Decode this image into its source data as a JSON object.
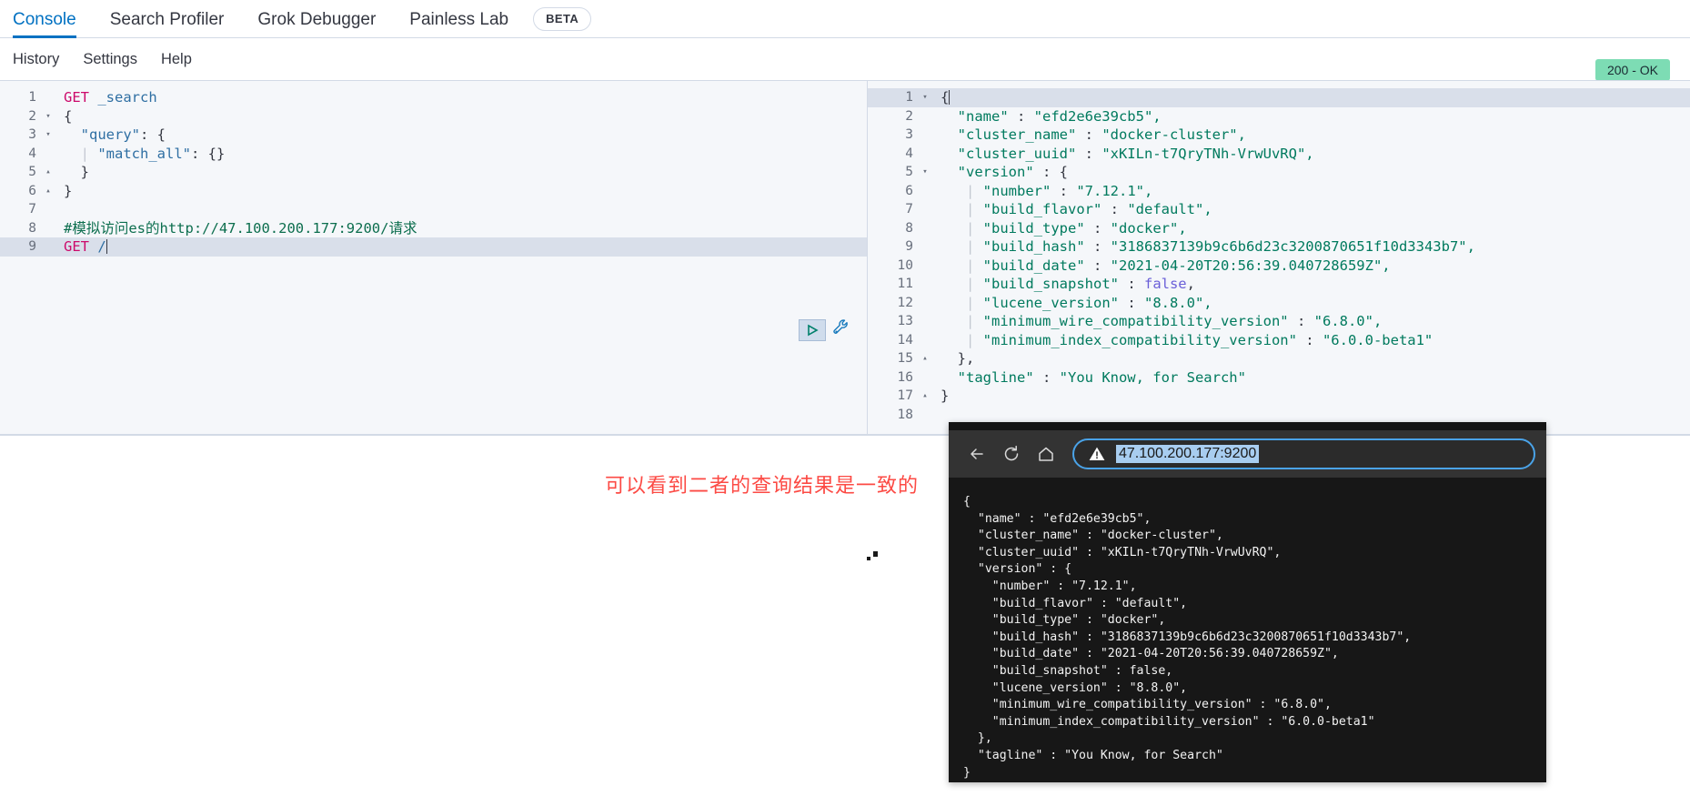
{
  "tabs": [
    {
      "label": "Console",
      "active": true
    },
    {
      "label": "Search Profiler",
      "active": false
    },
    {
      "label": "Grok Debugger",
      "active": false
    },
    {
      "label": "Painless Lab",
      "active": false
    }
  ],
  "beta_label": "BETA",
  "menu": [
    {
      "label": "History"
    },
    {
      "label": "Settings"
    },
    {
      "label": "Help"
    }
  ],
  "status": {
    "text": "200 - OK",
    "color": "#7ddcb4"
  },
  "editor": {
    "lines": [
      {
        "n": "1",
        "fold": "",
        "segments": [
          {
            "t": "GET ",
            "c": "kw"
          },
          {
            "t": "_search",
            "c": "prop"
          }
        ]
      },
      {
        "n": "2",
        "fold": "▾",
        "segments": [
          {
            "t": "{",
            "c": "punc"
          }
        ]
      },
      {
        "n": "3",
        "fold": "▾",
        "segments": [
          {
            "t": "  \"query\"",
            "c": "prop"
          },
          {
            "t": ": {",
            "c": "punc"
          }
        ]
      },
      {
        "n": "4",
        "fold": "",
        "segments": [
          {
            "t": "  ",
            "c": "punc"
          },
          {
            "t": "|",
            "c": "pipe"
          },
          {
            "t": " \"match_all\"",
            "c": "prop"
          },
          {
            "t": ": {}",
            "c": "punc"
          }
        ]
      },
      {
        "n": "5",
        "fold": "▴",
        "segments": [
          {
            "t": "  }",
            "c": "punc"
          }
        ]
      },
      {
        "n": "6",
        "fold": "▴",
        "segments": [
          {
            "t": "}",
            "c": "punc"
          }
        ]
      },
      {
        "n": "7",
        "fold": "",
        "segments": []
      },
      {
        "n": "8",
        "fold": "",
        "segments": [
          {
            "t": "#模拟访问es的http://47.100.200.177:9200/请求",
            "c": "cmt"
          }
        ]
      },
      {
        "n": "9",
        "fold": "",
        "segments": [
          {
            "t": "GET ",
            "c": "kw"
          },
          {
            "t": "/",
            "c": "prop"
          }
        ],
        "highlight": true,
        "cursor": true
      }
    ]
  },
  "response": {
    "lines": [
      {
        "n": "1",
        "fold": "▾",
        "segments": [
          {
            "t": "{",
            "c": "punc"
          }
        ],
        "highlight": true,
        "cursor": true
      },
      {
        "n": "2",
        "fold": "",
        "segments": [
          {
            "t": "  \"name\"",
            "c": "str"
          },
          {
            "t": " : ",
            "c": "punc"
          },
          {
            "t": "\"efd2e6e39cb5\",",
            "c": "str"
          }
        ]
      },
      {
        "n": "3",
        "fold": "",
        "segments": [
          {
            "t": "  \"cluster_name\"",
            "c": "str"
          },
          {
            "t": " : ",
            "c": "punc"
          },
          {
            "t": "\"docker-cluster\",",
            "c": "str"
          }
        ]
      },
      {
        "n": "4",
        "fold": "",
        "segments": [
          {
            "t": "  \"cluster_uuid\"",
            "c": "str"
          },
          {
            "t": " : ",
            "c": "punc"
          },
          {
            "t": "\"xKILn-t7QryTNh-VrwUvRQ\",",
            "c": "str"
          }
        ]
      },
      {
        "n": "5",
        "fold": "▾",
        "segments": [
          {
            "t": "  \"version\"",
            "c": "str"
          },
          {
            "t": " : {",
            "c": "punc"
          }
        ]
      },
      {
        "n": "6",
        "fold": "",
        "segments": [
          {
            "t": "   ",
            "c": "punc"
          },
          {
            "t": "|",
            "c": "pipe"
          },
          {
            "t": " \"number\"",
            "c": "str"
          },
          {
            "t": " : ",
            "c": "punc"
          },
          {
            "t": "\"7.12.1\",",
            "c": "str"
          }
        ]
      },
      {
        "n": "7",
        "fold": "",
        "segments": [
          {
            "t": "   ",
            "c": "punc"
          },
          {
            "t": "|",
            "c": "pipe"
          },
          {
            "t": " \"build_flavor\"",
            "c": "str"
          },
          {
            "t": " : ",
            "c": "punc"
          },
          {
            "t": "\"default\",",
            "c": "str"
          }
        ]
      },
      {
        "n": "8",
        "fold": "",
        "segments": [
          {
            "t": "   ",
            "c": "punc"
          },
          {
            "t": "|",
            "c": "pipe"
          },
          {
            "t": " \"build_type\"",
            "c": "str"
          },
          {
            "t": " : ",
            "c": "punc"
          },
          {
            "t": "\"docker\",",
            "c": "str"
          }
        ]
      },
      {
        "n": "9",
        "fold": "",
        "segments": [
          {
            "t": "   ",
            "c": "punc"
          },
          {
            "t": "|",
            "c": "pipe"
          },
          {
            "t": " \"build_hash\"",
            "c": "str"
          },
          {
            "t": " : ",
            "c": "punc"
          },
          {
            "t": "\"3186837139b9c6b6d23c3200870651f10d3343b7\",",
            "c": "str"
          }
        ]
      },
      {
        "n": "10",
        "fold": "",
        "segments": [
          {
            "t": "   ",
            "c": "punc"
          },
          {
            "t": "|",
            "c": "pipe"
          },
          {
            "t": " \"build_date\"",
            "c": "str"
          },
          {
            "t": " : ",
            "c": "punc"
          },
          {
            "t": "\"2021-04-20T20:56:39.040728659Z\",",
            "c": "str"
          }
        ]
      },
      {
        "n": "11",
        "fold": "",
        "segments": [
          {
            "t": "   ",
            "c": "punc"
          },
          {
            "t": "|",
            "c": "pipe"
          },
          {
            "t": " \"build_snapshot\"",
            "c": "str"
          },
          {
            "t": " : ",
            "c": "punc"
          },
          {
            "t": "false",
            "c": "bool"
          },
          {
            "t": ",",
            "c": "punc"
          }
        ]
      },
      {
        "n": "12",
        "fold": "",
        "segments": [
          {
            "t": "   ",
            "c": "punc"
          },
          {
            "t": "|",
            "c": "pipe"
          },
          {
            "t": " \"lucene_version\"",
            "c": "str"
          },
          {
            "t": " : ",
            "c": "punc"
          },
          {
            "t": "\"8.8.0\",",
            "c": "str"
          }
        ]
      },
      {
        "n": "13",
        "fold": "",
        "segments": [
          {
            "t": "   ",
            "c": "punc"
          },
          {
            "t": "|",
            "c": "pipe"
          },
          {
            "t": " \"minimum_wire_compatibility_version\"",
            "c": "str"
          },
          {
            "t": " : ",
            "c": "punc"
          },
          {
            "t": "\"6.8.0\",",
            "c": "str"
          }
        ]
      },
      {
        "n": "14",
        "fold": "",
        "segments": [
          {
            "t": "   ",
            "c": "punc"
          },
          {
            "t": "|",
            "c": "pipe"
          },
          {
            "t": " \"minimum_index_compatibility_version\"",
            "c": "str"
          },
          {
            "t": " : ",
            "c": "punc"
          },
          {
            "t": "\"6.0.0-beta1\"",
            "c": "str"
          }
        ]
      },
      {
        "n": "15",
        "fold": "▴",
        "segments": [
          {
            "t": "  },",
            "c": "punc"
          }
        ]
      },
      {
        "n": "16",
        "fold": "",
        "segments": [
          {
            "t": "  \"tagline\"",
            "c": "str"
          },
          {
            "t": " : ",
            "c": "punc"
          },
          {
            "t": "\"You Know, for Search\"",
            "c": "str"
          }
        ]
      },
      {
        "n": "17",
        "fold": "▴",
        "segments": [
          {
            "t": "}",
            "c": "punc"
          }
        ]
      },
      {
        "n": "18",
        "fold": "",
        "segments": []
      }
    ]
  },
  "actions": {
    "play_label": "run-request",
    "wrench_label": "copy-as-curl"
  },
  "annotation": {
    "text": "可以看到二者的查询结果是一致的",
    "color": "#fc4a44"
  },
  "browser": {
    "url": "47.100.200.177:9200",
    "nav": {
      "back": "←",
      "reload": "⟳",
      "home": "⌂"
    },
    "body": "{\n  \"name\" : \"efd2e6e39cb5\",\n  \"cluster_name\" : \"docker-cluster\",\n  \"cluster_uuid\" : \"xKILn-t7QryTNh-VrwUvRQ\",\n  \"version\" : {\n    \"number\" : \"7.12.1\",\n    \"build_flavor\" : \"default\",\n    \"build_type\" : \"docker\",\n    \"build_hash\" : \"3186837139b9c6b6d23c3200870651f10d3343b7\",\n    \"build_date\" : \"2021-04-20T20:56:39.040728659Z\",\n    \"build_snapshot\" : false,\n    \"lucene_version\" : \"8.8.0\",\n    \"minimum_wire_compatibility_version\" : \"6.8.0\",\n    \"minimum_index_compatibility_version\" : \"6.0.0-beta1\"\n  },\n  \"tagline\" : \"You Know, for Search\"\n}"
  }
}
